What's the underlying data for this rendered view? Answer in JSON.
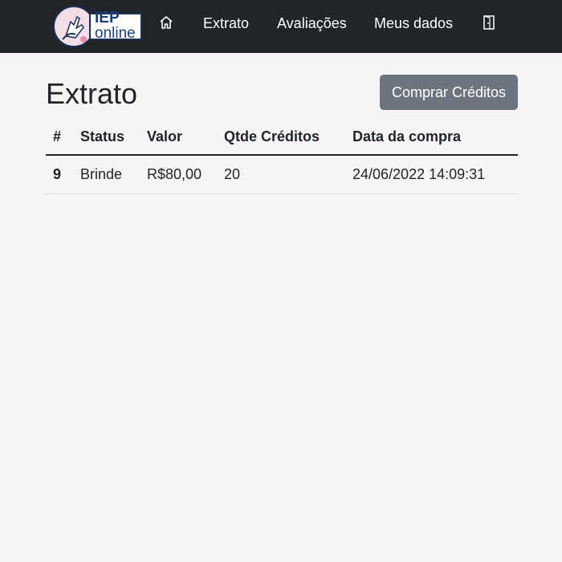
{
  "brand": {
    "logo_line1": "IEP",
    "logo_line2": "online"
  },
  "nav": {
    "home_icon": "home-icon",
    "items": [
      {
        "label": "Extrato"
      },
      {
        "label": "Avaliações"
      },
      {
        "label": "Meus dados"
      }
    ],
    "logout_icon": "door-exit-icon"
  },
  "main": {
    "title": "Extrato",
    "buy_button_label": "Comprar Créditos"
  },
  "table": {
    "headers": [
      "#",
      "Status",
      "Valor",
      "Qtde Créditos",
      "Data da compra"
    ],
    "rows": [
      {
        "id": "9",
        "status": "Brinde",
        "valor": "R$80,00",
        "qtde": "20",
        "data": "24/06/2022 14:09:31"
      }
    ]
  },
  "colors": {
    "navbar_bg": "#212529",
    "page_bg": "#f5f5f5",
    "button_bg": "#6c757d",
    "logo_blue": "#1b3f7a"
  }
}
